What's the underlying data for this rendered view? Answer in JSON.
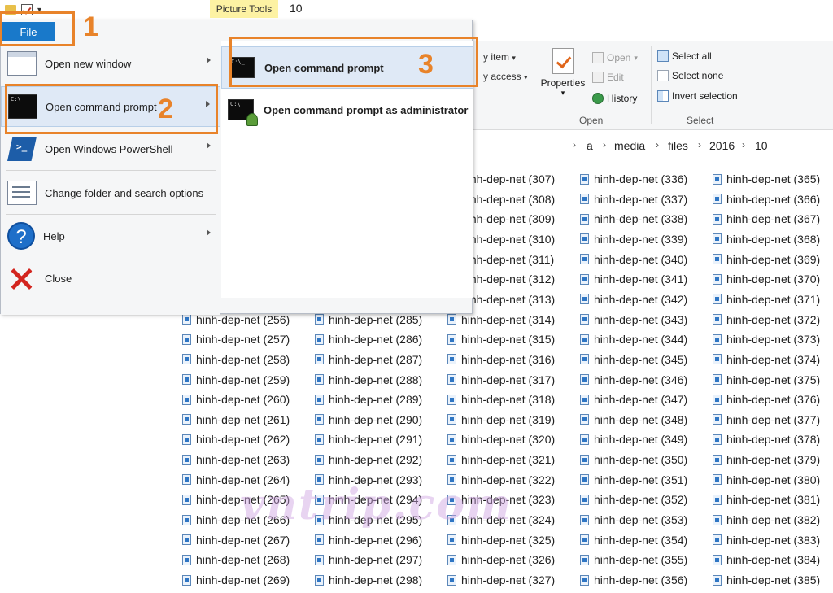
{
  "titlebar": {
    "contextual_tab": "Picture Tools",
    "folder_title": "10"
  },
  "file_menu": {
    "file_tab_label": "File",
    "items": [
      {
        "label": "Open new window",
        "icon": "window-icon",
        "has_submenu": true
      },
      {
        "label": "Open command prompt",
        "icon": "command-prompt-icon",
        "has_submenu": true
      },
      {
        "label": "Open Windows PowerShell",
        "icon": "powershell-icon",
        "has_submenu": true
      },
      {
        "label": "Change folder and search options",
        "icon": "folder-options-icon",
        "has_submenu": false
      },
      {
        "label": "Help",
        "icon": "help-icon",
        "has_submenu": true
      },
      {
        "label": "Close",
        "icon": "close-icon",
        "has_submenu": false
      }
    ],
    "submenu": [
      {
        "label": "Open command prompt",
        "icon": "command-prompt-icon"
      },
      {
        "label": "Open command prompt as administrator",
        "icon": "admin-command-prompt-icon"
      }
    ]
  },
  "annotations": {
    "step1": "1",
    "step2": "2",
    "step3": "3"
  },
  "ribbon": {
    "frag_item": "y item",
    "frag_access": "y access",
    "properties": "Properties",
    "open": "Open",
    "edit": "Edit",
    "history": "History",
    "open_group": "Open",
    "select_all": "Select all",
    "select_none": "Select none",
    "invert_selection": "Invert selection",
    "select_group": "Select"
  },
  "address": {
    "crumbs": [
      "a",
      "media",
      "files",
      "2016",
      "10"
    ]
  },
  "files": {
    "col1": [
      "hinh-dep-net (256)",
      "hinh-dep-net (257)",
      "hinh-dep-net (258)",
      "hinh-dep-net (259)",
      "hinh-dep-net (260)",
      "hinh-dep-net (261)",
      "hinh-dep-net (262)",
      "hinh-dep-net (263)",
      "hinh-dep-net (264)",
      "hinh-dep-net (265)",
      "hinh-dep-net (266)",
      "hinh-dep-net (267)",
      "hinh-dep-net (268)",
      "hinh-dep-net (269)"
    ],
    "col2": [
      "hinh-dep-net (285)",
      "hinh-dep-net (286)",
      "hinh-dep-net (287)",
      "hinh-dep-net (288)",
      "hinh-dep-net (289)",
      "hinh-dep-net (290)",
      "hinh-dep-net (291)",
      "hinh-dep-net (292)",
      "hinh-dep-net (293)",
      "hinh-dep-net (294)",
      "hinh-dep-net (295)",
      "hinh-dep-net (296)",
      "hinh-dep-net (297)",
      "hinh-dep-net (298)"
    ],
    "col3": [
      "hinh-dep-net (307)",
      "hinh-dep-net (308)",
      "hinh-dep-net (309)",
      "hinh-dep-net (310)",
      "hinh-dep-net (311)",
      "hinh-dep-net (312)",
      "hinh-dep-net (313)",
      "hinh-dep-net (314)",
      "hinh-dep-net (315)",
      "hinh-dep-net (316)",
      "hinh-dep-net (317)",
      "hinh-dep-net (318)",
      "hinh-dep-net (319)",
      "hinh-dep-net (320)",
      "hinh-dep-net (321)",
      "hinh-dep-net (322)",
      "hinh-dep-net (323)",
      "hinh-dep-net (324)",
      "hinh-dep-net (325)",
      "hinh-dep-net (326)",
      "hinh-dep-net (327)"
    ],
    "col4": [
      "hinh-dep-net (336)",
      "hinh-dep-net (337)",
      "hinh-dep-net (338)",
      "hinh-dep-net (339)",
      "hinh-dep-net (340)",
      "hinh-dep-net (341)",
      "hinh-dep-net (342)",
      "hinh-dep-net (343)",
      "hinh-dep-net (344)",
      "hinh-dep-net (345)",
      "hinh-dep-net (346)",
      "hinh-dep-net (347)",
      "hinh-dep-net (348)",
      "hinh-dep-net (349)",
      "hinh-dep-net (350)",
      "hinh-dep-net (351)",
      "hinh-dep-net (352)",
      "hinh-dep-net (353)",
      "hinh-dep-net (354)",
      "hinh-dep-net (355)",
      "hinh-dep-net (356)"
    ],
    "col5": [
      "hinh-dep-net (365)",
      "hinh-dep-net (366)",
      "hinh-dep-net (367)",
      "hinh-dep-net (368)",
      "hinh-dep-net (369)",
      "hinh-dep-net (370)",
      "hinh-dep-net (371)",
      "hinh-dep-net (372)",
      "hinh-dep-net (373)",
      "hinh-dep-net (374)",
      "hinh-dep-net (375)",
      "hinh-dep-net (376)",
      "hinh-dep-net (377)",
      "hinh-dep-net (378)",
      "hinh-dep-net (379)",
      "hinh-dep-net (380)",
      "hinh-dep-net (381)",
      "hinh-dep-net (382)",
      "hinh-dep-net (383)",
      "hinh-dep-net (384)",
      "hinh-dep-net (385)"
    ]
  },
  "watermark": "vntrip.com",
  "colors": {
    "annotation": "#e8832a",
    "file_tab": "#1979ca",
    "highlight": "#dfe9f6"
  }
}
